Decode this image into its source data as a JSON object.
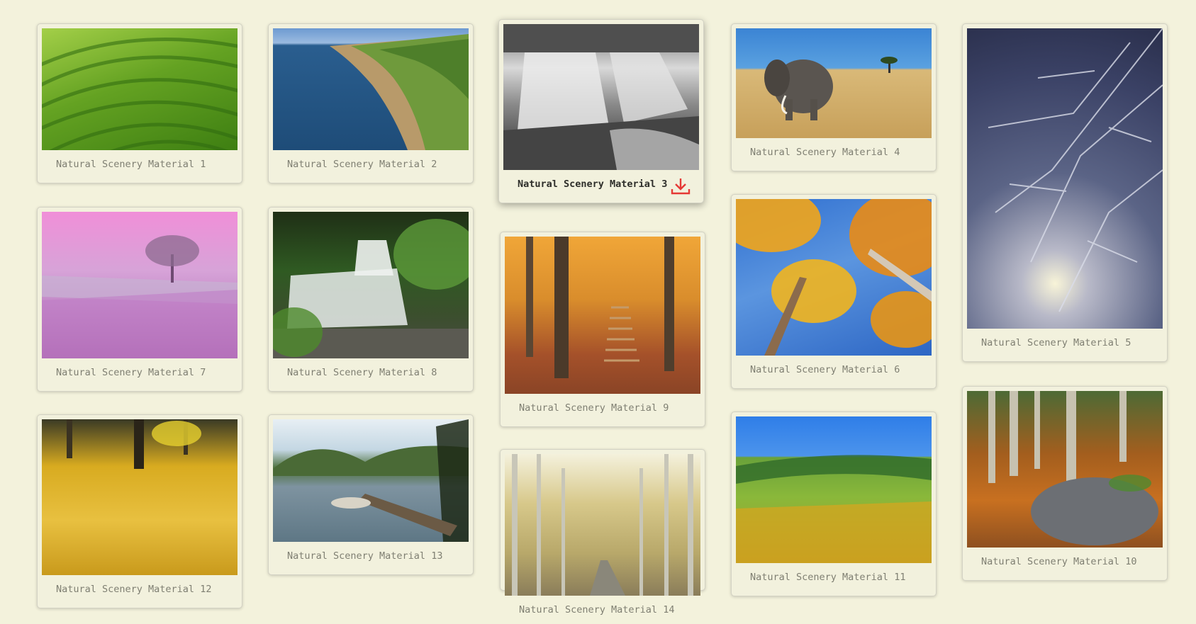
{
  "accent_color": "#e53935",
  "cards": [
    {
      "title": "Natural Scenery Material 1",
      "scene": "green tea terraces"
    },
    {
      "title": "Natural Scenery Material 2",
      "scene": "coastal cliff road"
    },
    {
      "title": "Natural Scenery Material 3",
      "scene": "black and white waterfall",
      "download_icon": "download-icon"
    },
    {
      "title": "Natural Scenery Material 4",
      "scene": "elephant in savanna"
    },
    {
      "title": "Natural Scenery Material 5",
      "scene": "frosted tree branches"
    },
    {
      "title": "Natural Scenery Material 7",
      "scene": "pink misty river with tree"
    },
    {
      "title": "Natural Scenery Material 8",
      "scene": "forest waterfall"
    },
    {
      "title": "Natural Scenery Material 9",
      "scene": "autumn forest steps"
    },
    {
      "title": "Natural Scenery Material 6",
      "scene": "golden trees against blue sky"
    },
    {
      "title": "Natural Scenery Material 12",
      "scene": "yellow leaves on forest floor"
    },
    {
      "title": "Natural Scenery Material 13",
      "scene": "lake with wooden pier"
    },
    {
      "title": "Natural Scenery Material 14",
      "scene": "tree lined road"
    },
    {
      "title": "Natural Scenery Material 11",
      "scene": "sunflower field"
    },
    {
      "title": "Natural Scenery Material 10",
      "scene": "aspen forest with ferns"
    }
  ]
}
